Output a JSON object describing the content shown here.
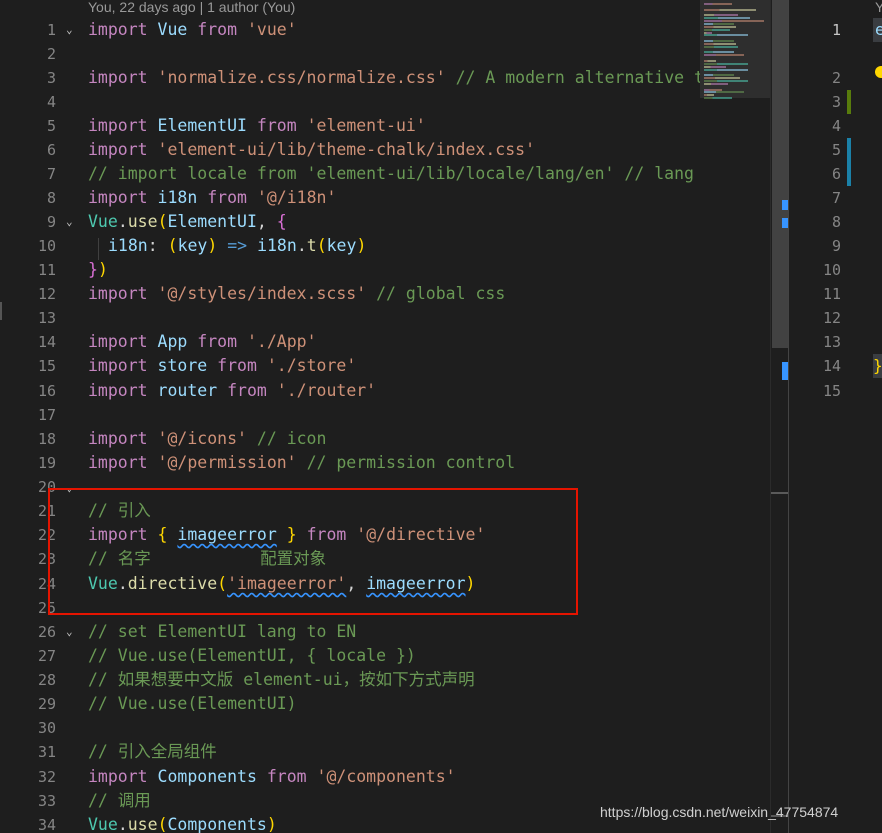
{
  "codelens": "You, 22 days ago | 1 author (You)",
  "line_numbers": [
    "1",
    "2",
    "3",
    "4",
    "5",
    "6",
    "7",
    "8",
    "9",
    "10",
    "11",
    "12",
    "13",
    "14",
    "15",
    "16",
    "17",
    "18",
    "19",
    "20",
    "21",
    "22",
    "23",
    "24",
    "25",
    "26",
    "27",
    "28",
    "29",
    "30",
    "31",
    "32",
    "33",
    "34"
  ],
  "code": {
    "l1": {
      "kw": "import",
      "id": "Vue",
      "from": "from",
      "str": "'vue'"
    },
    "l3": {
      "kw": "import",
      "str": "'normalize.css/normalize.css'",
      "cm": "// A modern alternative to"
    },
    "l5": {
      "kw": "import",
      "id": "ElementUI",
      "from": "from",
      "str": "'element-ui'"
    },
    "l6": {
      "kw": "import",
      "str": "'element-ui/lib/theme-chalk/index.css'"
    },
    "l7": {
      "cm": "// import locale from 'element-ui/lib/locale/lang/en' // lang i"
    },
    "l8": {
      "kw": "import",
      "id": "i18n",
      "from": "from",
      "str": "'@/i18n'"
    },
    "l9": {
      "cls": "Vue",
      "dot": ".",
      "fn": "use",
      "open": "(",
      "id": "ElementUI",
      ", ": ", ",
      "brace": "{"
    },
    "l10": {
      "prop": "i18n",
      "colon": ": ",
      "p1": "(",
      "arg": "key",
      "p2": ")",
      "arrow": " => ",
      "obj": "i18n",
      "dot": ".",
      "fn": "t",
      "p3": "(",
      "arg2": "key",
      "p4": ")"
    },
    "l11": {
      "brace": "}",
      "paren": ")"
    },
    "l12": {
      "kw": "import",
      "str": "'@/styles/index.scss'",
      "cm": "// global css"
    },
    "l14": {
      "kw": "import",
      "id": "App",
      "from": "from",
      "str": "'./App'"
    },
    "l15": {
      "kw": "import",
      "id": "store",
      "from": "from",
      "str": "'./store'"
    },
    "l16": {
      "kw": "import",
      "id": "router",
      "from": "from",
      "str": "'./router'"
    },
    "l18": {
      "kw": "import",
      "str": "'@/icons'",
      "cm": "// icon"
    },
    "l19": {
      "kw": "import",
      "str": "'@/permission'",
      "cm": "// permission control"
    },
    "l21": {
      "cm": "// 引入"
    },
    "l22": {
      "kw": "import",
      "ob": "{",
      "id": "imageerror",
      "cb": "}",
      "from": "from",
      "str": "'@/directive'"
    },
    "l23": {
      "cm": "// 名字           配置对象"
    },
    "l24": {
      "cls": "Vue",
      "dot": ".",
      "fn": "directive",
      "open": "(",
      "str": "'imageerror'",
      "comma": ", ",
      "id": "imageerror",
      "close": ")"
    },
    "l26": {
      "cm": "// set ElementUI lang to EN"
    },
    "l27": {
      "cm": "// Vue.use(ElementUI, { locale })"
    },
    "l28": {
      "cm": "// 如果想要中文版 element-ui，按如下方式声明"
    },
    "l29": {
      "cm": "// Vue.use(ElementUI)"
    },
    "l31": {
      "cm": "// 引入全局组件"
    },
    "l32": {
      "kw": "import",
      "id": "Components",
      "from": "from",
      "str": "'@/components'"
    },
    "l33": {
      "cm": "// 调用"
    },
    "l34": {
      "cls": "Vue",
      "dot": ".",
      "fn": "use",
      "open": "(",
      "id": "Components",
      "close": ")"
    }
  },
  "right_editor": {
    "line_numbers": [
      "1",
      "2",
      "3",
      "4",
      "5",
      "6",
      "7",
      "8",
      "9",
      "10",
      "11",
      "12",
      "13",
      "14",
      "15"
    ],
    "first_char": "e",
    "closing_brace": "}",
    "codelens_fragment": "Y"
  },
  "watermark": "https://blog.csdn.net/weixin_47754874",
  "colors": {
    "background": "#1e1e1e",
    "keyword": "#c586c0",
    "identifier": "#9cdcfe",
    "function": "#dcdcaa",
    "class": "#4ec9b0",
    "string": "#ce9178",
    "comment": "#6a9955",
    "highlight_box": "#e51400",
    "git_added": "#587c0c",
    "git_modified": "#1b81a8"
  }
}
